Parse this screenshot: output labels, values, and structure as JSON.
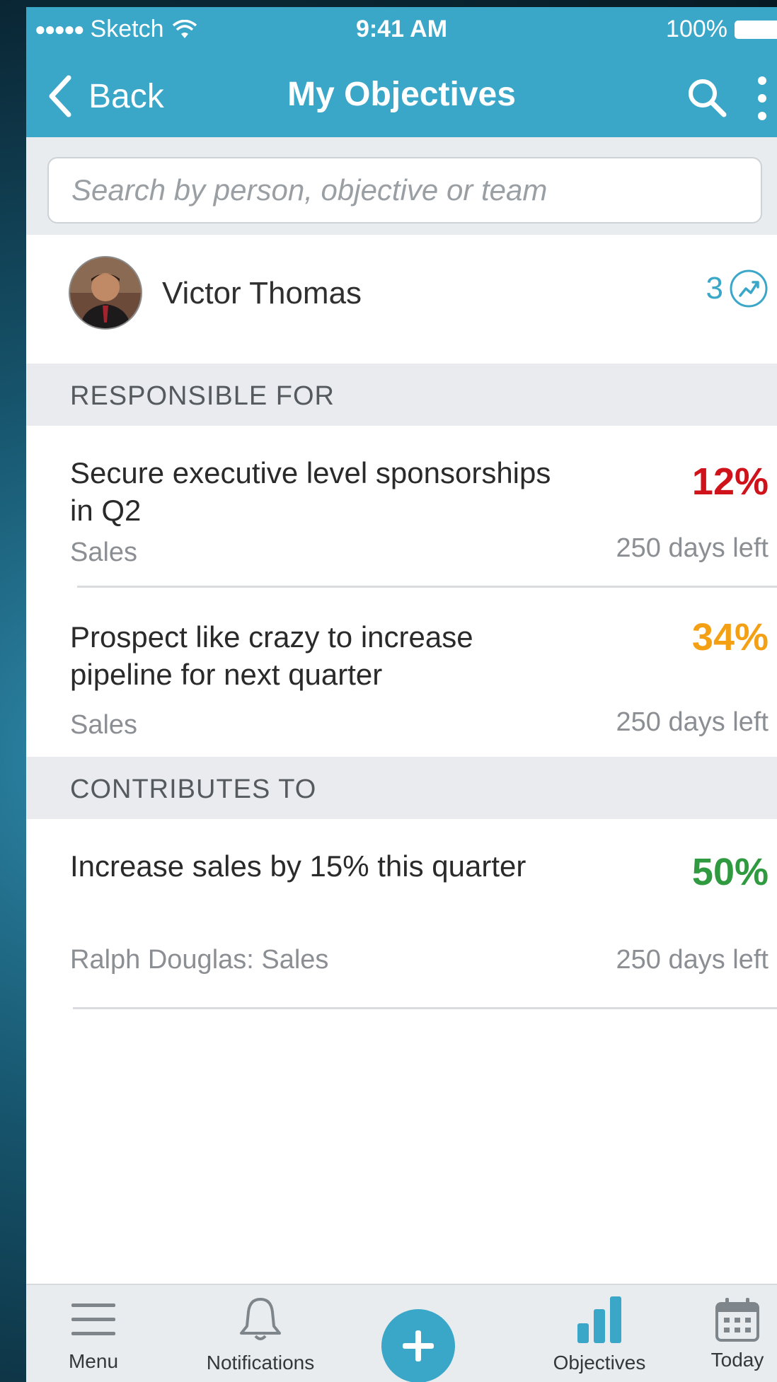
{
  "status_bar": {
    "carrier": "Sketch",
    "dots": "●●●●●",
    "time": "9:41 AM",
    "battery": "100%"
  },
  "nav": {
    "back_label": "Back",
    "title": "My Objectives"
  },
  "search": {
    "placeholder": "Search by person, objective or team"
  },
  "profile": {
    "name": "Victor Thomas",
    "trend_count": "3"
  },
  "sections": {
    "responsible_for": "RESPONSIBLE FOR",
    "contributes_to": "CONTRIBUTES TO"
  },
  "objectives": [
    {
      "title": "Secure executive level sponsorships in Q2",
      "team": "Sales",
      "progress": "12%",
      "days_left": "250 days left",
      "progress_color": "#d0121b"
    },
    {
      "title": "Prospect like crazy to increase pipeline for next quarter",
      "team": "Sales",
      "progress": "34%",
      "days_left": "250 days left",
      "progress_color": "#f4a015"
    },
    {
      "title": "Increase sales by 15% this quarter",
      "team": "Ralph Douglas: Sales",
      "progress": "50%",
      "days_left": "250 days left",
      "progress_color": "#2f9a3f"
    }
  ],
  "tabbar": {
    "menu": "Menu",
    "notifications": "Notifications",
    "objectives": "Objectives",
    "today": "Today"
  },
  "colors": {
    "accent": "#3aa7c9",
    "section_bg": "#e9ebee",
    "muted_text": "#8b8f93"
  },
  "icons": [
    "wifi-icon",
    "battery-icon",
    "chevron-left-icon",
    "search-icon",
    "more-vertical-icon",
    "trend-icon",
    "menu-icon",
    "bell-icon",
    "plus-icon",
    "bar-chart-icon",
    "calendar-icon"
  ]
}
